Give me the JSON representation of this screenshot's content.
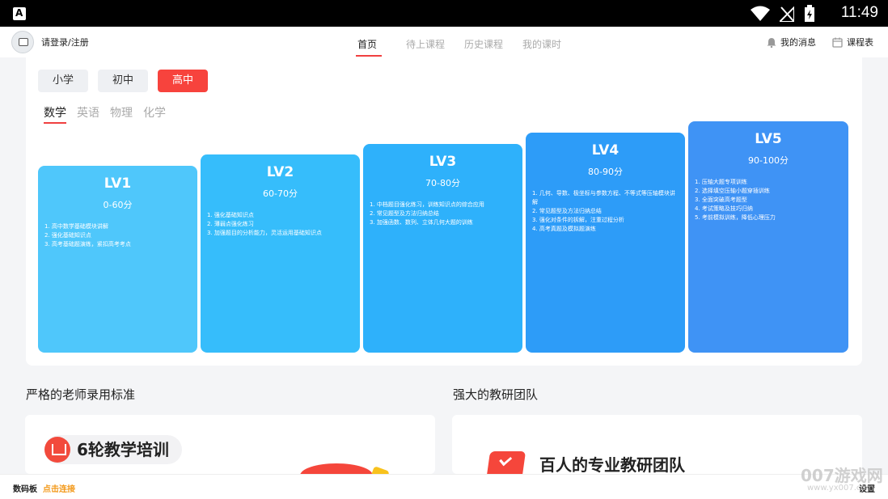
{
  "status_bar": {
    "time": "11:49"
  },
  "header": {
    "login": "请登录/注册",
    "tabs": [
      "首页",
      "待上课程",
      "历史课程",
      "我的课时"
    ],
    "active_tab": 0,
    "messages": "我的消息",
    "schedule": "课程表"
  },
  "grades": {
    "items": [
      "小学",
      "初中",
      "高中"
    ],
    "active": 2
  },
  "subjects": {
    "items": [
      "数学",
      "英语",
      "物理",
      "化学"
    ],
    "active": 0
  },
  "levels": [
    {
      "title": "LV1",
      "range": "0-60分",
      "color": "#4fc7fb",
      "items": [
        "1. 高中数学基础模块讲解",
        "2. 强化基础知识点",
        "3. 高考基础题演练，紧扣高考考点"
      ]
    },
    {
      "title": "LV2",
      "range": "60-70分",
      "color": "#36bdfb",
      "items": [
        "1. 强化基础知识点",
        "2. 薄弱点强化练习",
        "3. 加强题目的分析能力，灵活运用基础知识点"
      ]
    },
    {
      "title": "LV3",
      "range": "70-80分",
      "color": "#2eb1fb",
      "items": [
        "1. 中档题目强化练习，训练知识点的综合应用",
        "2. 常见题型及方法归纳总结",
        "3. 加强函数、数列、立体几何大题的训练"
      ]
    },
    {
      "title": "LV4",
      "range": "80-90分",
      "color": "#2d9cf8",
      "items": [
        "1. 几何、导数、极坐标与参数方程、不等式等压轴模块讲解",
        "2. 常见题型及方法归纳总结",
        "3. 强化对条件的拆解，注重过程分析",
        "4. 高考真题及模拟题演练"
      ]
    },
    {
      "title": "LV5",
      "range": "90-100分",
      "color": "#3f93f5",
      "items": [
        "1. 压轴大题专项训练",
        "2. 选择填空压轴小题穿插训练",
        "3. 全面突破高考题型",
        "4. 考试策略及技巧归纳",
        "5. 考前模拟训练，降低心理压力"
      ]
    }
  ],
  "sections": {
    "left_title": "严格的老师录用标准",
    "left_pill": "6轮教学培训",
    "right_title": "强大的教研团队",
    "right_heading": "百人的专业教研团队"
  },
  "bottom_bar": {
    "label": "数码板",
    "connect": "点击连接",
    "settings": "设置"
  },
  "watermark": {
    "text": "007游戏网",
    "url": "www.yx007.com"
  }
}
